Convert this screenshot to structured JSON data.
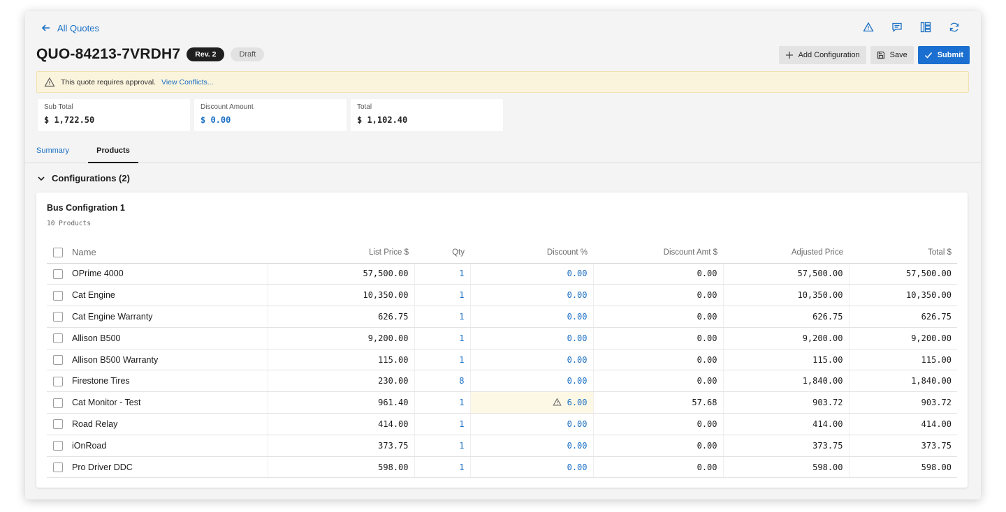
{
  "nav": {
    "back_label": "All Quotes"
  },
  "top_icons": [
    "warning-icon",
    "comment-icon",
    "layout-icon",
    "refresh-icon"
  ],
  "header": {
    "quote_id": "QUO-84213-7VRDH7",
    "revision": "Rev. 2",
    "status": "Draft"
  },
  "actions": {
    "add_configuration": "Add Configuration",
    "save": "Save",
    "submit": "Submit"
  },
  "alert": {
    "message": "This quote requires approval.",
    "link": "View Conflicts..."
  },
  "summary": [
    {
      "label": "Sub Total",
      "value": "$ 1,722.50"
    },
    {
      "label": "Discount Amount",
      "value": "$ 0.00"
    },
    {
      "label": "Total",
      "value": "$ 1,102.40"
    }
  ],
  "tabs": {
    "summary": "Summary",
    "products": "Products",
    "active": "Products"
  },
  "configurations": {
    "header": "Configurations (2)",
    "panel": {
      "title": "Bus Configration 1",
      "subtitle": "10 Products",
      "columns": [
        "Name",
        "List Price $",
        "Qty",
        "Discount %",
        "Discount Amt $",
        "Adjusted Price",
        "Total $"
      ],
      "rows": [
        {
          "name": "OPrime 4000",
          "list_price": "57,500.00",
          "qty": "1",
          "discount_pct": "0.00",
          "discount_amt": "0.00",
          "adjusted": "57,500.00",
          "total": "57,500.00",
          "warning": false
        },
        {
          "name": "Cat Engine",
          "list_price": "10,350.00",
          "qty": "1",
          "discount_pct": "0.00",
          "discount_amt": "0.00",
          "adjusted": "10,350.00",
          "total": "10,350.00",
          "warning": false
        },
        {
          "name": "Cat Engine Warranty",
          "list_price": "626.75",
          "qty": "1",
          "discount_pct": "0.00",
          "discount_amt": "0.00",
          "adjusted": "626.75",
          "total": "626.75",
          "warning": false
        },
        {
          "name": "Allison B500",
          "list_price": "9,200.00",
          "qty": "1",
          "discount_pct": "0.00",
          "discount_amt": "0.00",
          "adjusted": "9,200.00",
          "total": "9,200.00",
          "warning": false
        },
        {
          "name": "Allison B500 Warranty",
          "list_price": "115.00",
          "qty": "1",
          "discount_pct": "0.00",
          "discount_amt": "0.00",
          "adjusted": "115.00",
          "total": "115.00",
          "warning": false
        },
        {
          "name": "Firestone Tires",
          "list_price": "230.00",
          "qty": "8",
          "discount_pct": "0.00",
          "discount_amt": "0.00",
          "adjusted": "1,840.00",
          "total": "1,840.00",
          "warning": false
        },
        {
          "name": "Cat Monitor - Test",
          "list_price": "961.40",
          "qty": "1",
          "discount_pct": "6.00",
          "discount_amt": "57.68",
          "adjusted": "903.72",
          "total": "903.72",
          "warning": true
        },
        {
          "name": "Road Relay",
          "list_price": "414.00",
          "qty": "1",
          "discount_pct": "0.00",
          "discount_amt": "0.00",
          "adjusted": "414.00",
          "total": "414.00",
          "warning": false
        },
        {
          "name": "iOnRoad",
          "list_price": "373.75",
          "qty": "1",
          "discount_pct": "0.00",
          "discount_amt": "0.00",
          "adjusted": "373.75",
          "total": "373.75",
          "warning": false
        },
        {
          "name": "Pro Driver DDC",
          "list_price": "598.00",
          "qty": "1",
          "discount_pct": "0.00",
          "discount_amt": "0.00",
          "adjusted": "598.00",
          "total": "598.00",
          "warning": false
        }
      ]
    }
  },
  "colors": {
    "accent": "#1a6fd0",
    "link": "#1a6fc4",
    "alert_bg": "#fbf4dc",
    "warning_cell_bg": "#fdf8e6"
  }
}
